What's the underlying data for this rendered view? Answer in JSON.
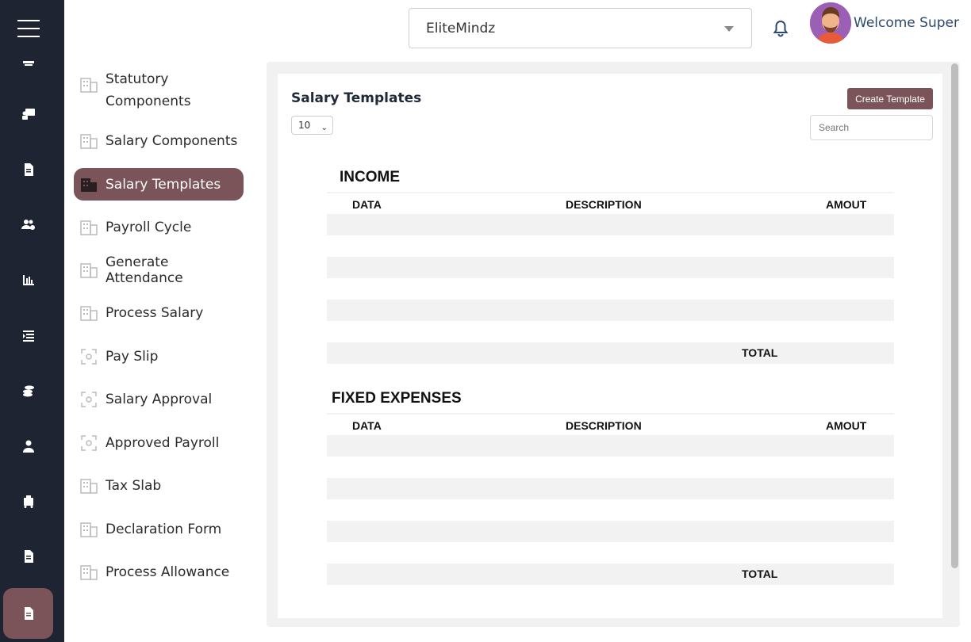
{
  "header": {
    "company_value": "EliteMindz",
    "welcome_text": "Welcome Super"
  },
  "rail": {
    "icons": [
      "menu-icon",
      "register-icon",
      "teacher-icon",
      "document-icon",
      "users-gear-icon",
      "chart-icon",
      "list-icon",
      "coins-icon",
      "user-badge-icon",
      "luggage-icon",
      "document-icon",
      "payroll-document-icon"
    ]
  },
  "submenu": {
    "items": [
      {
        "label": "Statutory Components",
        "icon": "building-icon"
      },
      {
        "label": "Salary Components",
        "icon": "building-icon"
      },
      {
        "label": "Salary Templates",
        "icon": "building-icon"
      },
      {
        "label": "Payroll Cycle",
        "icon": "building-icon"
      },
      {
        "label": "Generate Attendance",
        "icon": "building-icon"
      },
      {
        "label": "Process Salary",
        "icon": "building-icon"
      },
      {
        "label": "Pay Slip",
        "icon": "scan-icon"
      },
      {
        "label": "Salary Approval",
        "icon": "scan-icon"
      },
      {
        "label": "Approved Payroll",
        "icon": "scan-icon"
      },
      {
        "label": "Tax Slab",
        "icon": "building-icon"
      },
      {
        "label": "Declaration Form",
        "icon": "building-icon"
      },
      {
        "label": "Process Allowance",
        "icon": "building-icon"
      }
    ],
    "statutory_line1": "Statutory",
    "statutory_line2": "Components"
  },
  "main": {
    "title": "Salary Templates",
    "page_size": "10",
    "create_button": "Create Template",
    "search_placeholder": "Search",
    "income": {
      "title": "INCOME",
      "columns": [
        "DATA",
        "DESCRIPTION",
        "AMOUT"
      ],
      "total_label": "TOTAL"
    },
    "fixed_expenses": {
      "title": "FIXED EXPENSES",
      "columns": [
        "DATA",
        "DESCRIPTION",
        "AMOUT"
      ],
      "total_label": "TOTAL"
    }
  },
  "colors": {
    "accent": "#7a5458",
    "rail_bg": "#1f2433"
  }
}
